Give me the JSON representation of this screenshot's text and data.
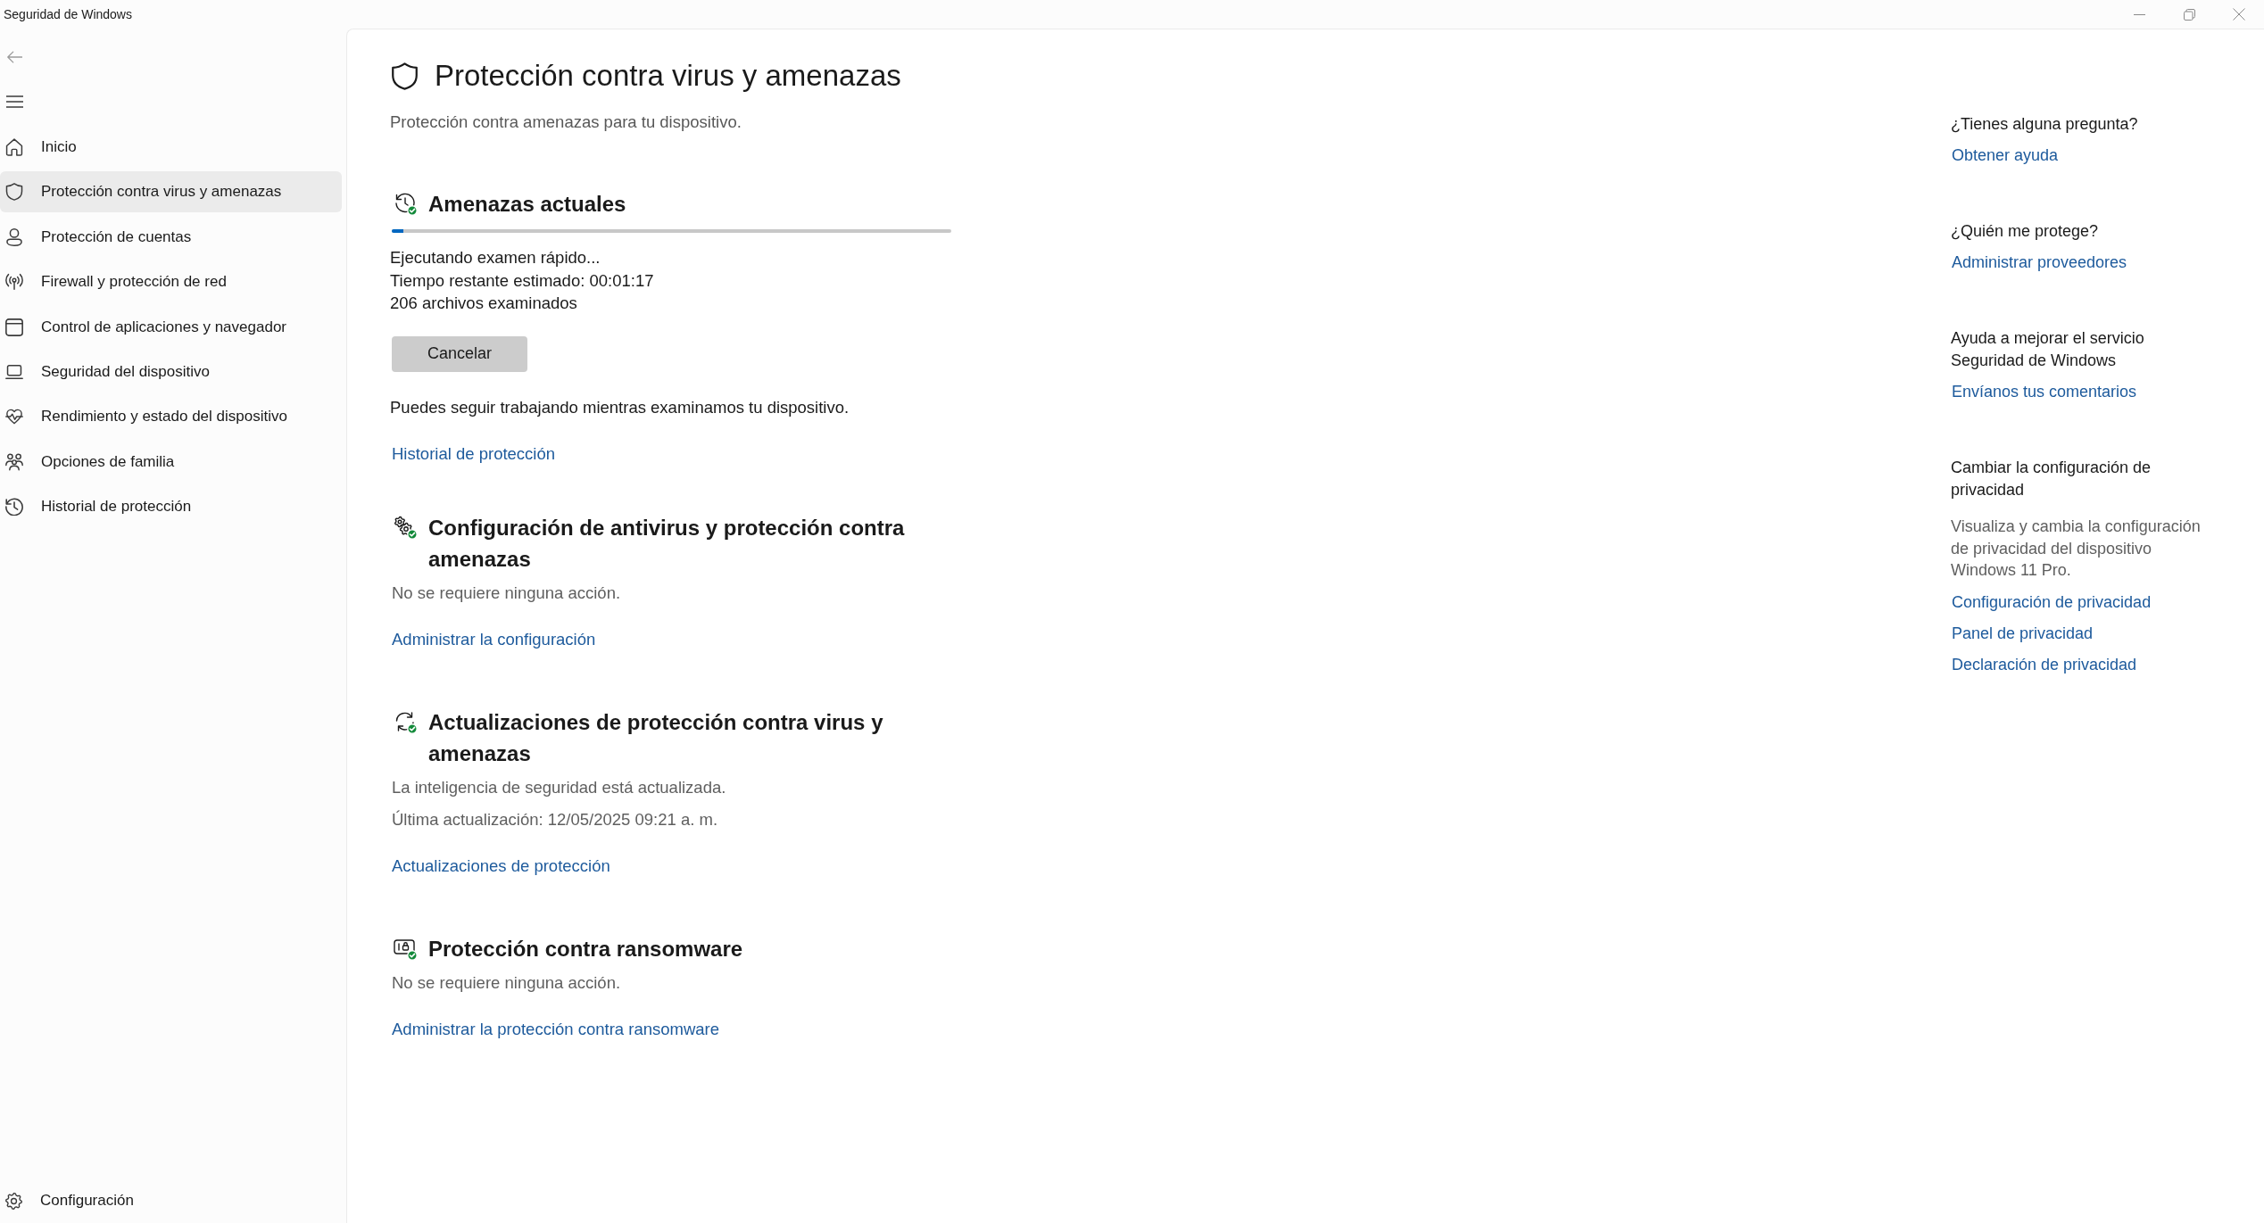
{
  "window": {
    "title": "Seguridad de Windows"
  },
  "nav": {
    "items": [
      {
        "label": "Inicio",
        "selected": false
      },
      {
        "label": "Protección contra virus y amenazas",
        "selected": true
      },
      {
        "label": "Protección de cuentas",
        "selected": false
      },
      {
        "label": "Firewall y protección de red",
        "selected": false
      },
      {
        "label": "Control de aplicaciones y navegador",
        "selected": false
      },
      {
        "label": "Seguridad del dispositivo",
        "selected": false
      },
      {
        "label": "Rendimiento y estado del dispositivo",
        "selected": false
      },
      {
        "label": "Opciones de familia",
        "selected": false
      },
      {
        "label": "Historial de protección",
        "selected": false
      }
    ],
    "footer": {
      "label": "Configuración"
    }
  },
  "page": {
    "title": "Protección contra virus y amenazas",
    "subtitle": "Protección contra amenazas para tu dispositivo."
  },
  "sections": [
    {
      "kind": "scan",
      "title": "Amenazas actuales",
      "progress": {
        "level": 0.02
      },
      "lines": [
        "Ejecutando examen rápido...",
        "Tiempo restante estimado: 00:01:17",
        "206 archivos examinados"
      ],
      "button": "Cancelar",
      "note": "Puedes seguir trabajando mientras examinamos tu dispositivo.",
      "link": "Historial de protección"
    },
    {
      "kind": "status",
      "title": "Configuración de antivirus y protección contra amenazas",
      "lines": [
        "No se requiere ninguna acción."
      ],
      "link": "Administrar la configuración"
    },
    {
      "kind": "status",
      "title": "Actualizaciones de protección contra virus y amenazas",
      "lines": [
        "La inteligencia de seguridad está actualizada.",
        "Última actualización: 12/05/2025 09:21 a. m."
      ],
      "link": "Actualizaciones de protección"
    },
    {
      "kind": "status",
      "title": "Protección contra ransomware",
      "lines": [
        "No se requiere ninguna acción."
      ],
      "link": "Administrar la protección contra ransomware"
    }
  ],
  "side_panel": [
    {
      "heading": "¿Tienes alguna pregunta?",
      "links": [
        "Obtener ayuda"
      ]
    },
    {
      "heading": "¿Quién me protege?",
      "links": [
        "Administrar proveedores"
      ]
    },
    {
      "heading": "Ayuda a mejorar el servicio Seguridad de Windows",
      "links": [
        "Envíanos tus comentarios"
      ]
    },
    {
      "heading": "Cambiar la configuración de privacidad",
      "description": "Visualiza y cambia la configuración de privacidad del dispositivo Windows 11 Pro.",
      "links": [
        "Configuración de privacidad",
        "Panel de privacidad",
        "Declaración de privacidad"
      ]
    }
  ]
}
